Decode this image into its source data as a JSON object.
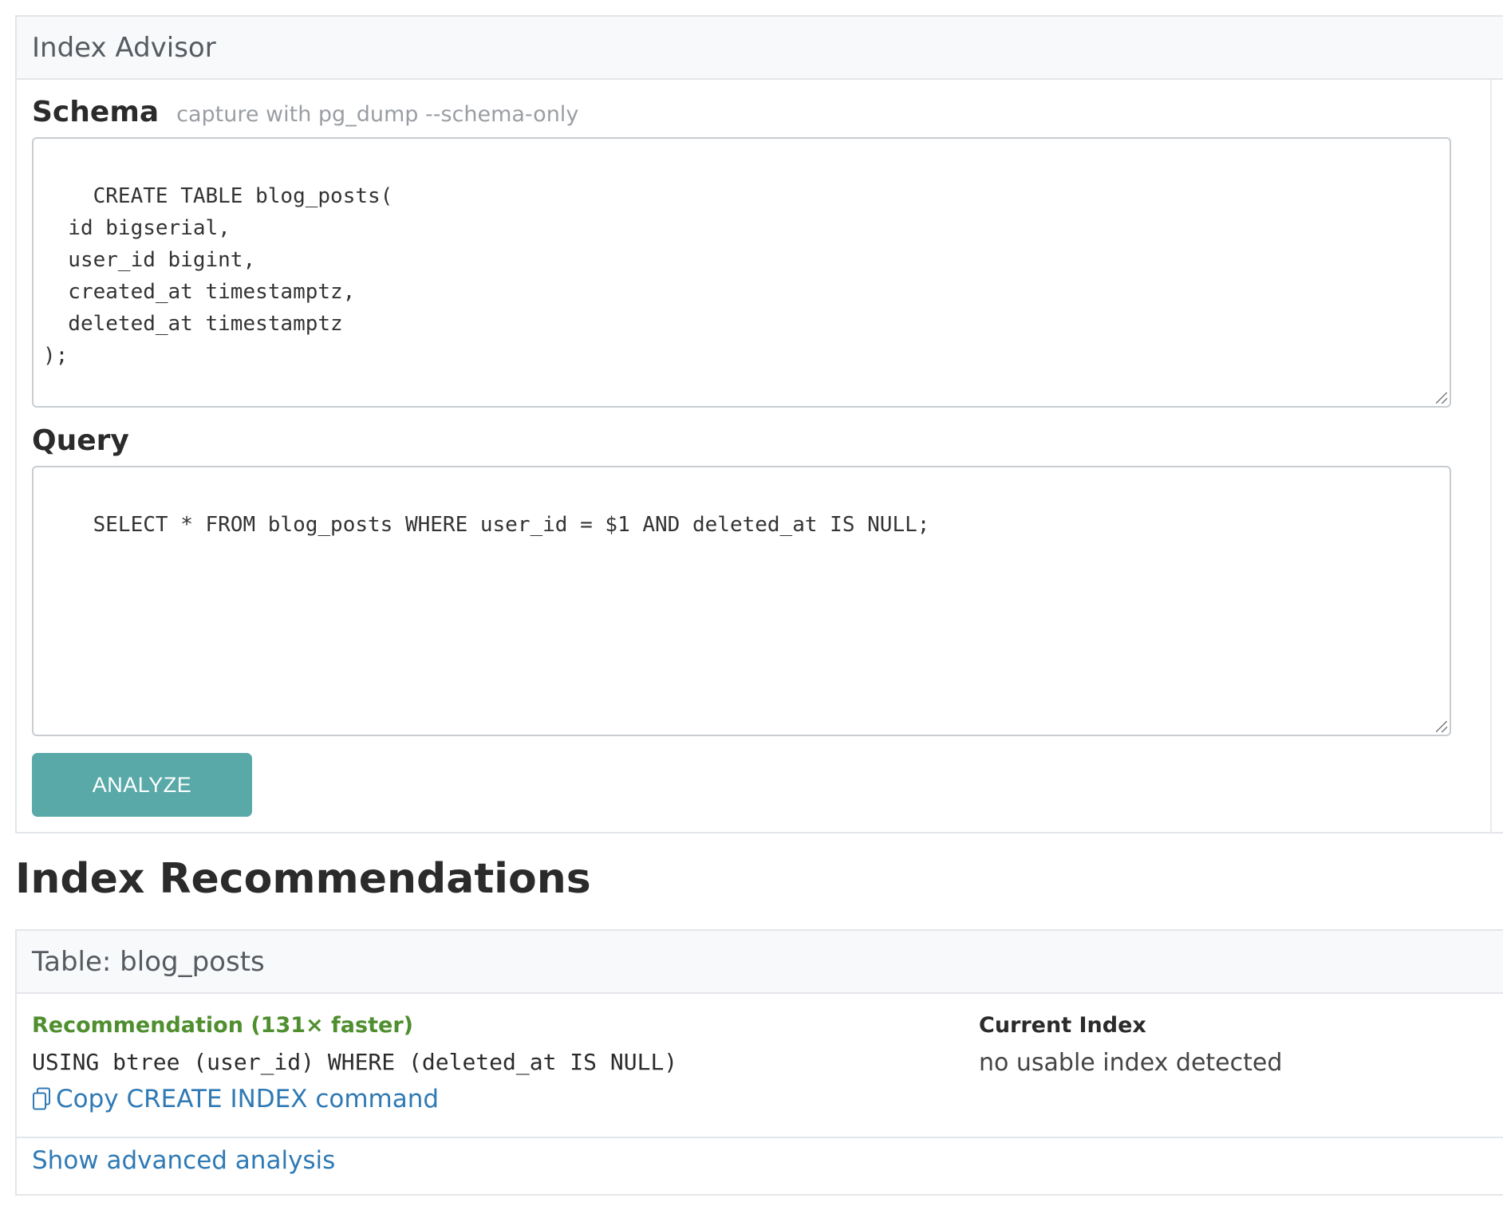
{
  "advisor": {
    "title": "Index Advisor",
    "schema": {
      "label": "Schema",
      "hint": "capture with pg_dump --schema-only",
      "value": "CREATE TABLE blog_posts(\n  id bigserial,\n  user_id bigint,\n  created_at timestamptz,\n  deleted_at timestamptz\n);"
    },
    "query": {
      "label": "Query",
      "value": "SELECT * FROM blog_posts WHERE user_id = $1 AND deleted_at IS NULL;"
    },
    "analyze_label": "ANALYZE"
  },
  "recommendations": {
    "title": "Index Recommendations",
    "table_heading": "Table: blog_posts",
    "recommendation_label": "Recommendation (131× faster)",
    "recommendation_sql": "USING btree (user_id) WHERE (deleted_at IS NULL)",
    "copy_label": "Copy CREATE INDEX command",
    "current_index_label": "Current Index",
    "current_index_value": "no usable index detected",
    "advanced_label": "Show advanced analysis"
  },
  "colors": {
    "accent_button": "#5aa9a9",
    "link": "#2f7ab5",
    "success": "#4f8f2f"
  },
  "icons": {
    "copy": "copy-icon"
  }
}
